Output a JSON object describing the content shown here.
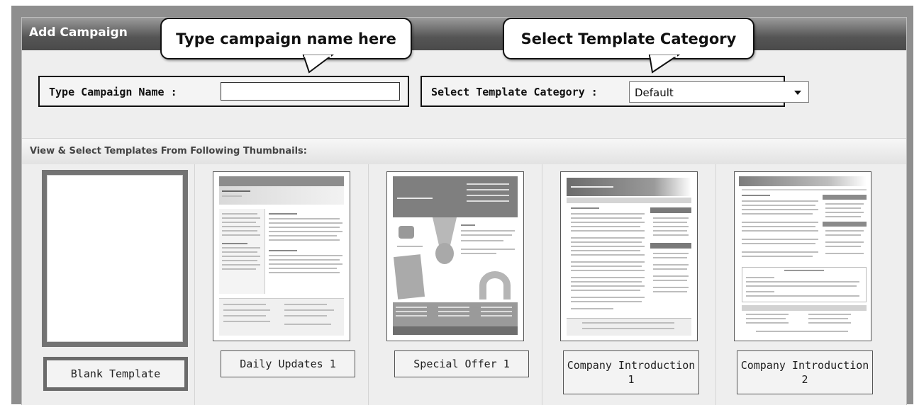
{
  "panel": {
    "title": "Add Campaign"
  },
  "callouts": {
    "name_hint": "Type campaign name here",
    "category_hint": "Select Template Category"
  },
  "campaign_name": {
    "label": "Type Campaign Name :",
    "value": ""
  },
  "template_category": {
    "label": "Select Template Category :",
    "selected": "Default"
  },
  "templates_section": {
    "heading": "View & Select Templates From Following Thumbnails:"
  },
  "templates": [
    {
      "label": "Blank Template",
      "selected": true
    },
    {
      "label": "Daily Updates 1"
    },
    {
      "label": "Special Offer 1"
    },
    {
      "label": "Company Introduction 1"
    },
    {
      "label": "Company Introduction 2"
    }
  ],
  "colors": {
    "header_dark": "#4a4a4a",
    "panel_bg": "#eeeeee",
    "outer_bg": "#8e8e8e",
    "selected_border": "#6a6a6a"
  }
}
